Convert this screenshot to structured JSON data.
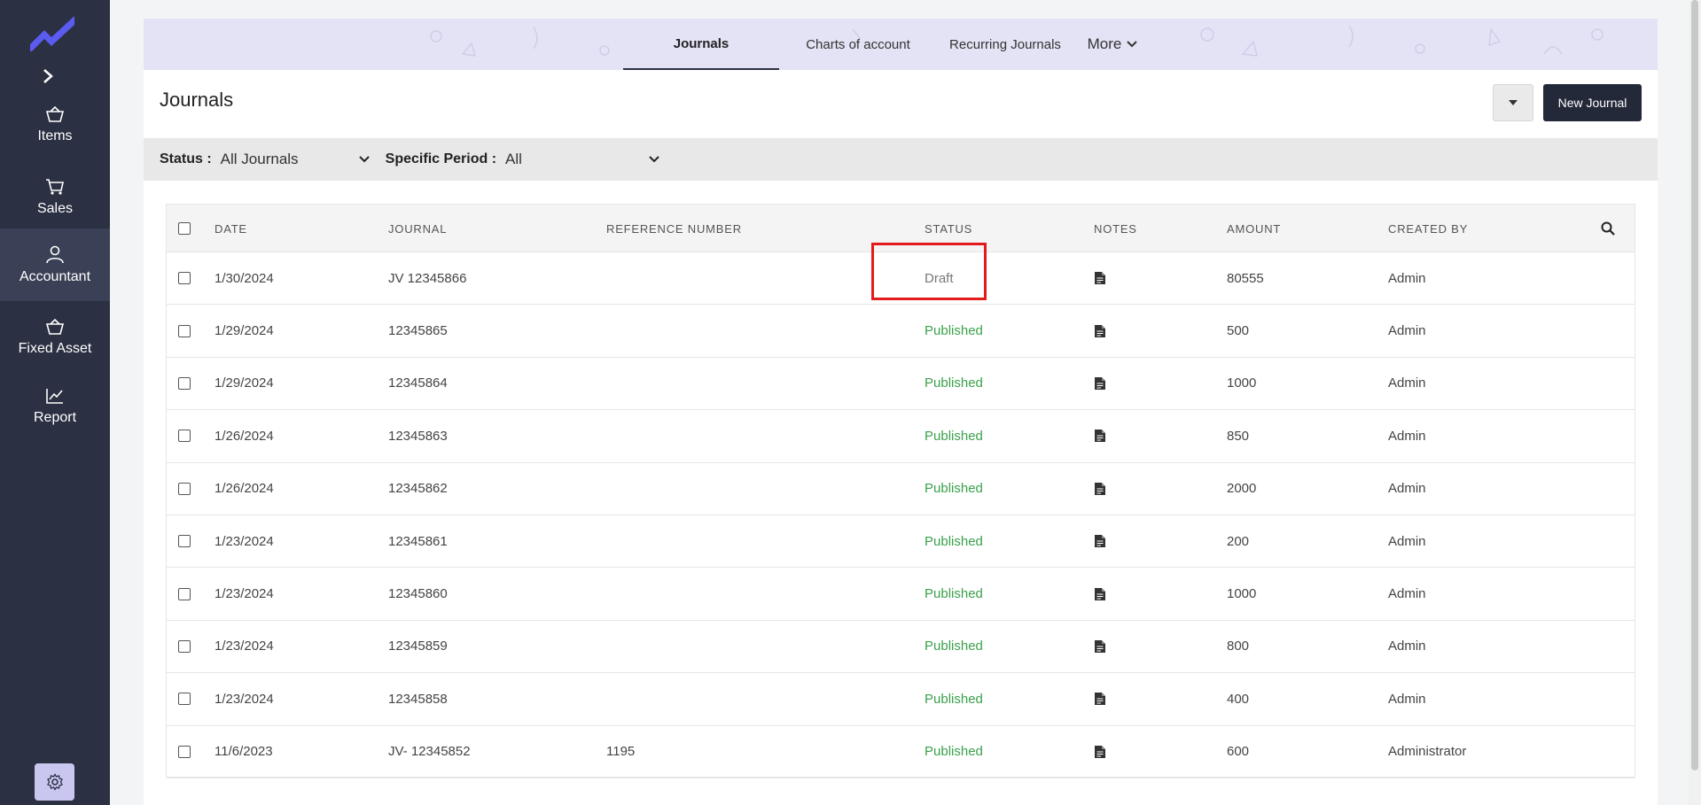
{
  "sidebar": {
    "items": [
      {
        "label": "Items",
        "icon": "basket-icon"
      },
      {
        "label": "Sales",
        "icon": "cart-icon"
      },
      {
        "label": "Accountant",
        "icon": "user-icon"
      },
      {
        "label": "Fixed Asset",
        "icon": "basket-icon"
      },
      {
        "label": "Report",
        "icon": "chart-icon"
      }
    ],
    "active": "Accountant"
  },
  "tabs": [
    {
      "label": "Journals"
    },
    {
      "label": "Charts of account"
    },
    {
      "label": "Recurring Journals"
    },
    {
      "label": "More"
    }
  ],
  "header": {
    "title": "Journals",
    "new_button": "New Journal"
  },
  "filters": {
    "status_label": "Status :",
    "status_value": "All Journals",
    "period_label": "Specific Period :",
    "period_value": "All"
  },
  "table": {
    "columns": [
      "DATE",
      "JOURNAL",
      "REFERENCE NUMBER",
      "STATUS",
      "NOTES",
      "AMOUNT",
      "CREATED BY"
    ],
    "rows": [
      {
        "date": "1/30/2024",
        "journal": "JV 12345866",
        "reference": "",
        "status": "Draft",
        "amount": "80555",
        "created_by": "Admin"
      },
      {
        "date": "1/29/2024",
        "journal": "12345865",
        "reference": "",
        "status": "Published",
        "amount": "500",
        "created_by": "Admin"
      },
      {
        "date": "1/29/2024",
        "journal": "12345864",
        "reference": "",
        "status": "Published",
        "amount": "1000",
        "created_by": "Admin"
      },
      {
        "date": "1/26/2024",
        "journal": "12345863",
        "reference": "",
        "status": "Published",
        "amount": "850",
        "created_by": "Admin"
      },
      {
        "date": "1/26/2024",
        "journal": "12345862",
        "reference": "",
        "status": "Published",
        "amount": "2000",
        "created_by": "Admin"
      },
      {
        "date": "1/23/2024",
        "journal": "12345861",
        "reference": "",
        "status": "Published",
        "amount": "200",
        "created_by": "Admin"
      },
      {
        "date": "1/23/2024",
        "journal": "12345860",
        "reference": "",
        "status": "Published",
        "amount": "1000",
        "created_by": "Admin"
      },
      {
        "date": "1/23/2024",
        "journal": "12345859",
        "reference": "",
        "status": "Published",
        "amount": "800",
        "created_by": "Admin"
      },
      {
        "date": "1/23/2024",
        "journal": "12345858",
        "reference": "",
        "status": "Published",
        "amount": "400",
        "created_by": "Admin"
      },
      {
        "date": "11/6/2023",
        "journal": "JV- 12345852",
        "reference": "1195",
        "status": "Published",
        "amount": "600",
        "created_by": "Administrator"
      }
    ]
  },
  "colors": {
    "sidebar_bg": "#2b3043",
    "accent_logo": "#5b5bf0",
    "published": "#3aa14b",
    "draft": "#777777",
    "highlight": "#e21b1b",
    "primary_button": "#24293a"
  }
}
